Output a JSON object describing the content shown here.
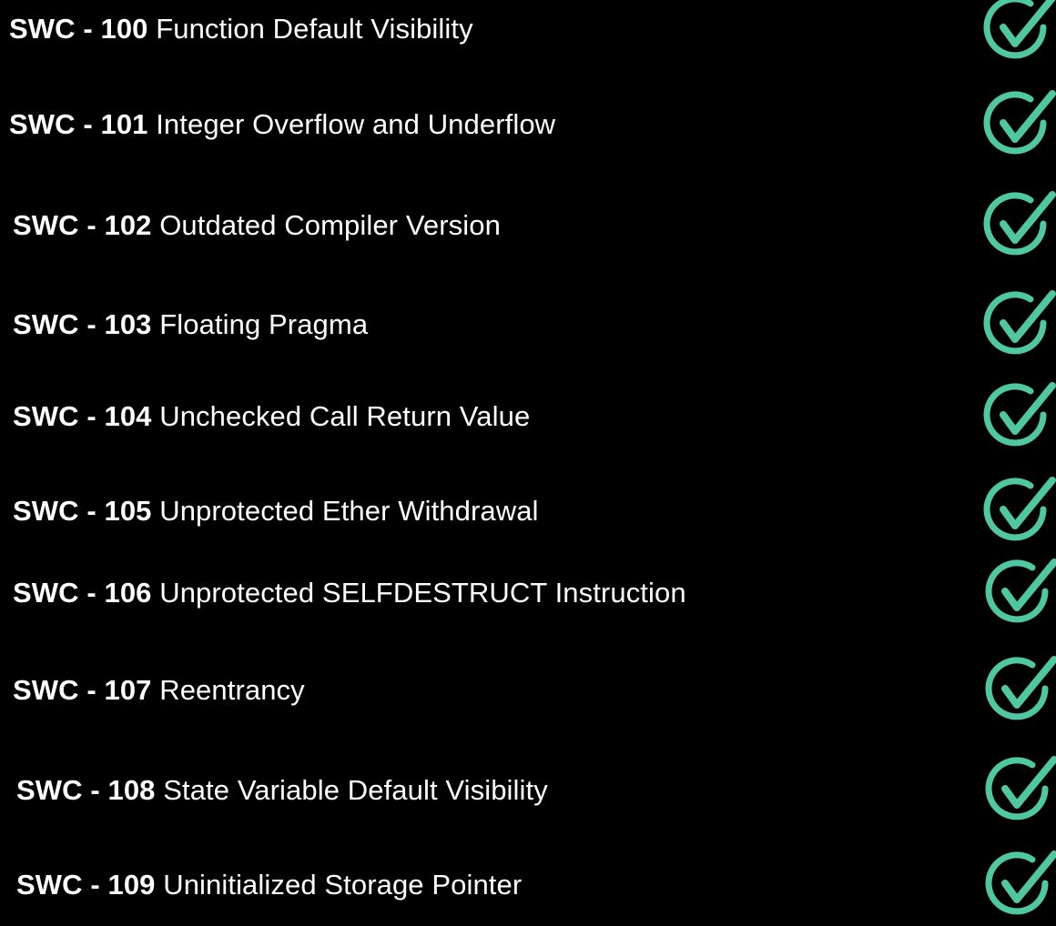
{
  "colors": {
    "background": "#000000",
    "text": "#ffffff",
    "check_accent": "#4fc7a0"
  },
  "icon": "check-circle-icon",
  "items": [
    {
      "code": "SWC - 100",
      "title": "Function Default Visibility",
      "status": "checked"
    },
    {
      "code": "SWC - 101",
      "title": "Integer Overflow and Underflow",
      "status": "checked"
    },
    {
      "code": "SWC - 102",
      "title": "Outdated Compiler Version",
      "status": "checked"
    },
    {
      "code": "SWC - 103",
      "title": "Floating Pragma",
      "status": "checked"
    },
    {
      "code": "SWC - 104",
      "title": "Unchecked Call Return Value",
      "status": "checked"
    },
    {
      "code": "SWC - 105",
      "title": "Unprotected Ether Withdrawal",
      "status": "checked"
    },
    {
      "code": "SWC - 106",
      "title": "Unprotected SELFDESTRUCT Instruction",
      "status": "checked"
    },
    {
      "code": "SWC - 107",
      "title": "Reentrancy",
      "status": "checked"
    },
    {
      "code": "SWC - 108",
      "title": "State Variable Default Visibility",
      "status": "checked"
    },
    {
      "code": "SWC - 109",
      "title": "Uninitialized Storage Pointer",
      "status": "checked"
    }
  ]
}
